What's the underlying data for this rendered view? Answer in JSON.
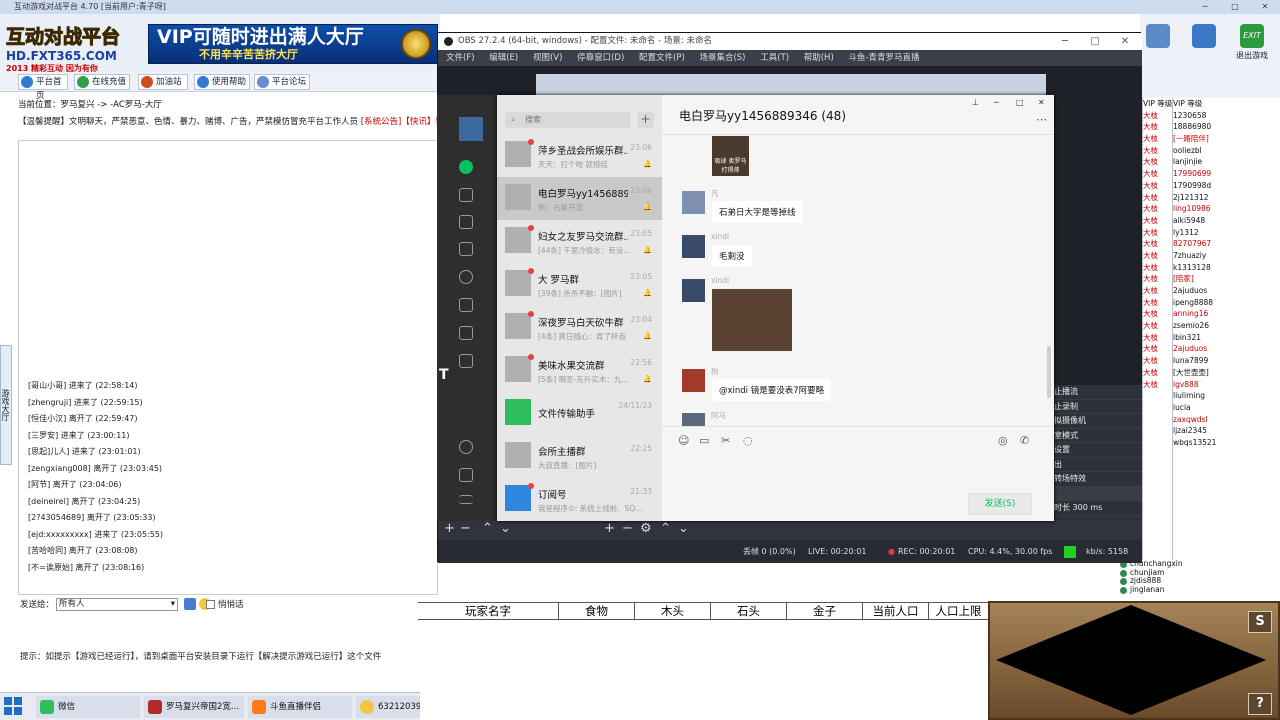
{
  "platform": {
    "window_title": "互动游戏对战平台 4.70 [当前用户:青子呀]",
    "logo_main": "互动对战平台",
    "logo_site": "HD.FXT365.COM",
    "logo_slogan": "2013 精彩互动 因为有你",
    "ad_line1": "VIP可随时进出满人大厅",
    "ad_line2": "不用辛辛苦苦挤大厅",
    "toolbar": [
      "平台首页",
      "在线充值",
      "加油站",
      "使用帮助",
      "平台论坛"
    ],
    "current_position": "当前位置：罗马复兴 -> -AC罗马-大厅",
    "notice_prefix": "【温馨提醒】文明聊天，严禁恶意、色情、暴力、赌博、广告，严禁模仿冒充平台工作人员",
    "notice_red": "[系统公告]【快讯】黎昌 玩家 bing500 成功开通互动平台超级VIP8，获得尊贵身份特权！",
    "sidebar_vertical": "游戏大厅",
    "log_lines": [
      "[哥山小哥] 进来了 (22:58:14)",
      "[zhengruji] 进来了 (22:59:15)",
      "[恒佳小汉] 离开了 (22:59:47)",
      "[三罗安] 进来了 (23:00:11)",
      "[思起]儿人] 进来了 (23:01:01)",
      "[zengxiang008] 离开了 (23:03:45)",
      "[阿节] 离开了 (23:04:06)",
      "[deineirel] 离开了 (23:04:25)",
      "[2?43054689] 离开了 (23:05:33)",
      "[ejd:xxxxxxxxx] 进来了 (23:05:55)",
      "[苦哈哈同] 离开了 (23:08:08)",
      "[不=诶原始] 离开了 (23:08:16)"
    ],
    "send_to_label": "发送给：",
    "send_to_value": "所有人",
    "private_chat": "悄悄话",
    "hint": "提示：如提示【游戏已经运行】，请到桌面平台安装目录下运行【解决提示游戏已运行】这个文件",
    "stats_headers": [
      "玩家名字",
      "食物",
      "木头",
      "石头",
      "金子",
      "当前人口",
      "人口上限"
    ]
  },
  "obs": {
    "title": "OBS 27.2.4 (64-bit, windows) - 配置文件: 未命名 - 场景: 未命名",
    "menu": [
      "文件(F)",
      "编辑(E)",
      "视图(V)",
      "停靠窗口(D)",
      "配置文件(P)",
      "场景集合(S)",
      "工具(T)",
      "帮助(H)",
      "斗鱼-青青罗马直播"
    ],
    "scenes_label": "场景",
    "right_items": [
      "止播流",
      "止录制",
      "拟摄像机",
      "室模式",
      "设置",
      "出",
      "转场特效",
      "",
      "时长  300 ms"
    ],
    "status_dropped": "丢帧 0 (0.0%)",
    "status_live": "LIVE: 00:20:01",
    "status_rec": "REC: 00:20:01",
    "status_cpu": "CPU: 4.4%, 30.00 fps",
    "status_kbps": "kb/s: 5158"
  },
  "wechat": {
    "search_placeholder": "搜索",
    "chat_title": "电白罗马yy1456889346 (48)",
    "conversations": [
      {
        "name": "萍乡圣战会所娱乐群...",
        "preview": "天天：打个吻 就捞结",
        "time": "23:06",
        "unread": true
      },
      {
        "name": "电白罗马yy1456889...",
        "preview": "狗：右第开流",
        "time": "23:06",
        "unread": false
      },
      {
        "name": "妇女之友罗马交流群...",
        "preview": "[44条] 千里冷情水：有没...",
        "time": "23:05",
        "unread": true
      },
      {
        "name": "大 罗马群",
        "preview": "[39条] 杀杀不触：[图片]",
        "time": "23:05",
        "unread": true
      },
      {
        "name": "深夜罗马白天砍牛群",
        "preview": "[4条] 爽日随心：肯了杯吞",
        "time": "23:04",
        "unread": true
      },
      {
        "name": "美味水果交流群",
        "preview": "[5条] 啊圣-东升实木：九...",
        "time": "22:56",
        "unread": true
      },
      {
        "name": "文件传输助手",
        "preview": "",
        "time": "24/11/23",
        "unread": false
      },
      {
        "name": "会所主播群",
        "preview": "大叔直播：[图片]",
        "time": "22:25",
        "unread": false
      },
      {
        "name": "订阅号",
        "preview": "我是程序①: 系统上线前、SQ...",
        "time": "21:33",
        "unread": true
      }
    ],
    "messages": [
      {
        "who": "凡",
        "text": "石弟日大字是等掉线"
      },
      {
        "who": "xindi",
        "text": "毛剩没"
      },
      {
        "who": "xindi",
        "text": ""
      },
      {
        "who": "狗",
        "text": "@xindi 镜是要没表7阿要略"
      },
      {
        "who": "阿马",
        "text": ""
      }
    ],
    "image_caption": "吸球 卖罗马打得帅",
    "send_button": "发送(S)"
  },
  "desktop_right": {
    "icons": [
      "",
      "",
      "EXIT"
    ],
    "exit_label": "退出游戏",
    "list_left": [
      "VIP 等级",
      "大枝",
      "大枝",
      "大枝",
      "大枝",
      "大枝",
      "大枝",
      "大枝",
      "大枝",
      "大枝",
      "大枝",
      "大枝",
      "大枝",
      "大枝",
      "大枝",
      "大枝",
      "大枝",
      "大枝",
      "大枝",
      "大枝",
      "大枝",
      "大枝",
      "大枝",
      "大枝",
      "大枝"
    ],
    "list_right": [
      "VIP 等级",
      "1230658",
      "18886980",
      "[一路陪伴]",
      "ooliezbl",
      "lanjinjie",
      "17990699",
      "1790998d",
      "2j121312",
      "ling10986",
      "aiki5948",
      "ly1312",
      "82707967",
      "7zhuaziy",
      "k1313128",
      "[陪家]",
      "2ajuduos",
      "ipeng8888",
      "anning16",
      "zsemio26",
      "lbin321",
      "2ajuduos",
      "luna7899",
      "[大世壶壶]",
      "lgv888",
      "liuliming",
      "lucia",
      "zaxqwdsl",
      "ljzai2345",
      "wbqs13521"
    ],
    "bottom": [
      "chunchangxin",
      "chunjiam",
      "zjdis888",
      "jinglanan"
    ]
  },
  "taskbar": [
    "微信",
    "罗马复兴帝国2宽...",
    "斗鱼直播伴侣",
    "63212039"
  ]
}
